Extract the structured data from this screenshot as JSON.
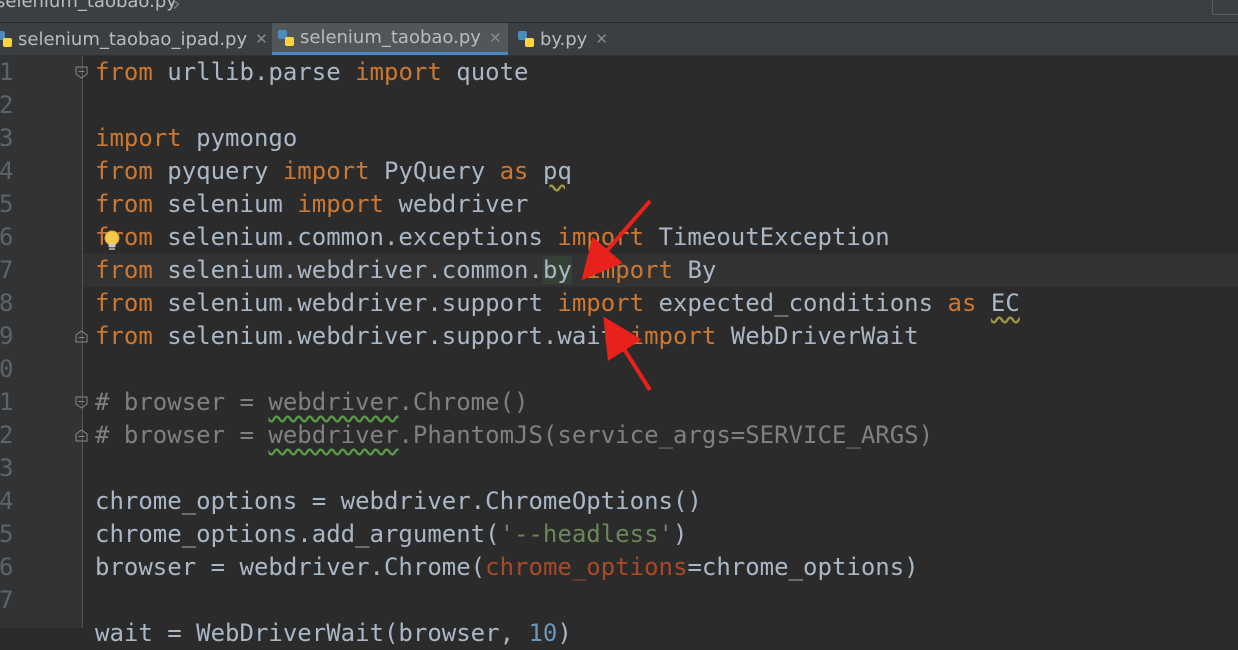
{
  "breadcrumb": {
    "file": "selenium_taobao.py"
  },
  "tabs": [
    {
      "label": "selenium_taobao_ipad.py",
      "close": "✕"
    },
    {
      "label": "selenium_taobao.py",
      "close": "✕"
    },
    {
      "label": "by.py",
      "close": "✕"
    }
  ],
  "active_tab": "selenium_taobao.py",
  "line_numbers": [
    "1",
    "2",
    "3",
    "4",
    "5",
    "6",
    "7",
    "8",
    "9",
    "0",
    "1",
    "2",
    "3",
    "4",
    "5",
    "6",
    "7"
  ],
  "code": {
    "l1": {
      "kw1": "from",
      "t1": " urllib.parse ",
      "kw2": "import",
      "t2": " quote"
    },
    "l3": {
      "kw1": "import",
      "t1": " pymongo"
    },
    "l4": {
      "kw1": "from",
      "t1": " pyquery ",
      "kw2": "import",
      "t2": " PyQuery ",
      "kw3": "as",
      "t3": " ",
      "alias": "pq"
    },
    "l5": {
      "kw1": "from",
      "t1": " selenium ",
      "kw2": "import",
      "t2": " webdriver"
    },
    "l6": {
      "kw1": "from",
      "t1": " selenium.common.exceptions ",
      "kw2": "import",
      "t2": " TimeoutException"
    },
    "l7": {
      "kw1": "from",
      "t1": " selenium.webdriver.common.",
      "mod": "by",
      "t1b": " ",
      "kw2": "import",
      "t2": " By"
    },
    "l8": {
      "kw1": "from",
      "t1": " selenium.webdriver.support ",
      "kw2": "import",
      "t2": " expected_conditions ",
      "kw3": "as",
      "t3": " ",
      "alias": "EC"
    },
    "l9": {
      "kw1": "from",
      "t1": " selenium.webdriver.support.wait ",
      "kw2": "import",
      "t2": " WebDriverWait"
    },
    "l11": {
      "c1": "# browser = ",
      "cw": "webdriver",
      "c2": ".Chrome()"
    },
    "l12": {
      "c1": "# browser = ",
      "cw": "webdriver",
      "c2": ".PhantomJS(service_args=SERVICE_ARGS)"
    },
    "l14": {
      "t1": "chrome_options = webdriver.ChromeOptions()"
    },
    "l15": {
      "t1": "chrome_options.add_argument(",
      "s1": "'--headless'",
      "t2": ")"
    },
    "l16": {
      "t1": "browser = webdriver.Chrome(",
      "p1": "chrome_options",
      "t2": "=chrome_options)"
    },
    "l18": {
      "t1": "wait = WebDriverWait(browser, ",
      "n1": "10",
      "t2": ")"
    }
  },
  "colors": {
    "keyword": "#cc7832",
    "comment": "#808080",
    "string": "#6a8759",
    "number": "#6897bb",
    "param": "#aa4926",
    "text": "#a9b7c6",
    "arrow": "#e8221a",
    "tab_underline": "#4a88c7"
  },
  "icons": [
    "python-file-icon",
    "lightbulb-icon",
    "fold-marker-icon",
    "red-arrow-annotation"
  ]
}
